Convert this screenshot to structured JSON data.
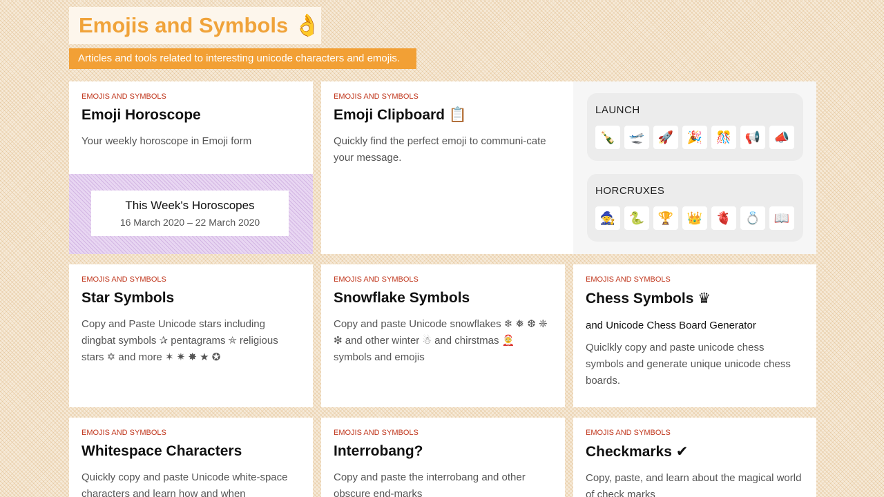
{
  "hero": {
    "title": "Emojis and Symbols 👌",
    "subtitle": "Articles and tools related to interesting unicode characters and emojis."
  },
  "tag_label": "EMOJIS AND SYMBOLS",
  "cards": {
    "horoscope": {
      "title": "Emoji Horoscope",
      "desc": "Your weekly horoscope in Emoji form",
      "box_title": "This Week's Horoscopes",
      "box_date": "16 March 2020 – 22 March 2020"
    },
    "clipboard": {
      "title": "Emoji Clipboard 📋",
      "desc": "Quickly find the perfect emoji to communi-cate your message."
    },
    "star": {
      "title": "Star Symbols",
      "desc": "Copy and Paste Unicode stars including dingbat symbols ✰ pentagrams ⛤ religious stars ✡ and more ✶ ✷ ✸ ★ ✪"
    },
    "snowflake": {
      "title": "Snowflake Symbols",
      "desc": "Copy and paste Unicode snowflakes ❄ ❅ ❆ ❈ ❇ and other winter ☃ and chirstmas 🤶 symbols and emojis"
    },
    "chess": {
      "title": "Chess Symbols ♛",
      "subtitle": "and Unicode Chess Board Generator",
      "desc": "Quiclkly copy and paste unicode chess symbols and generate unique unicode chess boards."
    },
    "whitespace": {
      "title": "Whitespace Characters",
      "desc": "Quickly copy and paste Unicode white-space characters and learn how and when"
    },
    "interrobang": {
      "title": "Interrobang?",
      "desc": "Copy and paste the interrobang and other obscure end-marks"
    },
    "checkmarks": {
      "title": "Checkmarks ✔",
      "desc": "Copy, paste, and learn about the magical world of check marks"
    }
  },
  "clipboard_panel": {
    "launch": {
      "title": "LAUNCH",
      "emojis": [
        "🍾",
        "🛫",
        "🚀",
        "🎉",
        "🎊",
        "📢",
        "📣"
      ]
    },
    "horcruxes": {
      "title": "HORCRUXES",
      "emojis": [
        "🧙",
        "🐍",
        "🏆",
        "👑",
        "🫀",
        "💍",
        "📖"
      ]
    }
  }
}
